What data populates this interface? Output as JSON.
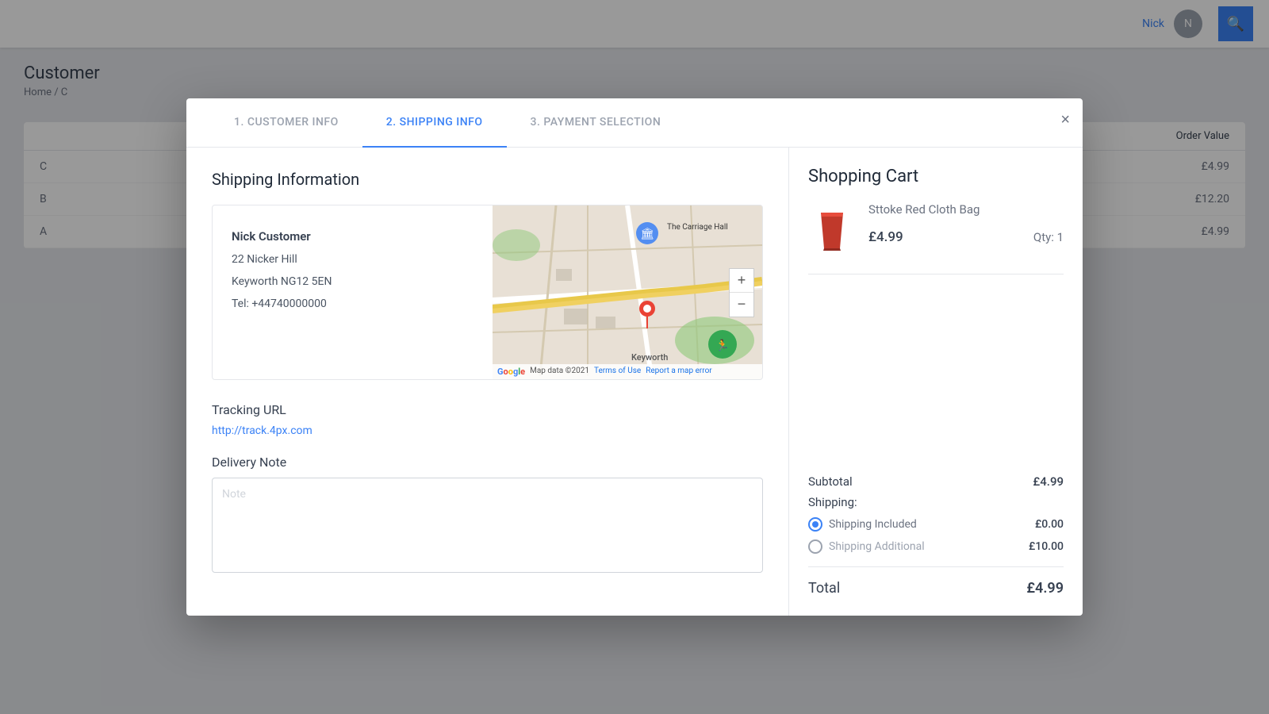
{
  "background": {
    "header": {
      "username": "Nick",
      "search_icon": "🔍"
    },
    "page_title": "Customer",
    "breadcrumb": "Home / C",
    "table": {
      "header": {
        "order_value_label": "Order Value"
      },
      "rows": [
        {
          "id": "C",
          "value": "£4.99"
        },
        {
          "id": "B",
          "value": "£12.20"
        },
        {
          "id": "A",
          "value": "£4.99"
        }
      ]
    }
  },
  "modal": {
    "close_label": "×",
    "tabs": [
      {
        "id": "customer-info",
        "label": "1. CUSTOMER INFO",
        "active": false
      },
      {
        "id": "shipping-info",
        "label": "2. SHIPPING INFO",
        "active": true
      },
      {
        "id": "payment-selection",
        "label": "3. PAYMENT SELECTION",
        "active": false
      }
    ],
    "left_panel": {
      "section_title": "Shipping Information",
      "customer": {
        "name": "Nick Customer",
        "address1": "22 Nicker Hill",
        "address2": "Keyworth NG12 5EN",
        "tel": "Tel: +44740000000"
      },
      "map": {
        "zoom_in": "+",
        "zoom_out": "−",
        "footer_text": "Map data ©2021",
        "terms_link": "Terms of Use",
        "report_link": "Report a map error",
        "location_label": "Keyworth"
      },
      "tracking": {
        "label": "Tracking URL",
        "url": "http://track.4px.com"
      },
      "delivery": {
        "label": "Delivery Note",
        "placeholder": "Note"
      }
    },
    "right_panel": {
      "cart_title": "Shopping Cart",
      "product": {
        "name": "Sttoke Red Cloth Bag",
        "price": "£4.99",
        "qty_label": "Qty: 1"
      },
      "summary": {
        "subtotal_label": "Subtotal",
        "subtotal_value": "£4.99",
        "shipping_label": "Shipping:",
        "shipping_included_label": "Shipping Included",
        "shipping_included_value": "£0.00",
        "shipping_additional_label": "Shipping Additional",
        "shipping_additional_value": "£10.00",
        "total_label": "Total",
        "total_value": "£4.99"
      }
    }
  }
}
